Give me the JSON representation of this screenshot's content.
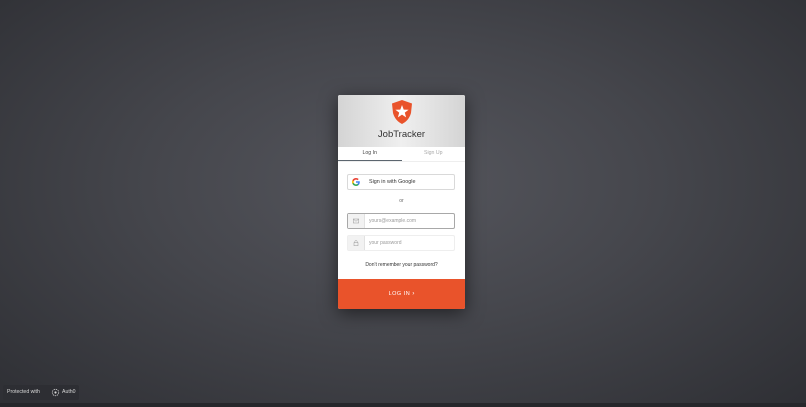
{
  "app": {
    "title": "JobTracker"
  },
  "tabs": [
    {
      "label": "Log In",
      "active": true
    },
    {
      "label": "Sign Up",
      "active": false
    }
  ],
  "social": {
    "google_label": "Sign in with Google"
  },
  "separator": {
    "text": "or"
  },
  "fields": {
    "email": {
      "placeholder": "yours@example.com",
      "value": "",
      "icon": "envelope-icon"
    },
    "password": {
      "placeholder": "your password",
      "value": "",
      "icon": "lock-icon"
    }
  },
  "forgot": {
    "label": "Don't remember your password?"
  },
  "submit": {
    "label": "LOG IN",
    "icon": "chevron-right-icon"
  },
  "footer_badge": {
    "text": "Protected with",
    "brand": "Auth0"
  },
  "colors": {
    "accent": "#e9532b",
    "background": "#45464c"
  }
}
